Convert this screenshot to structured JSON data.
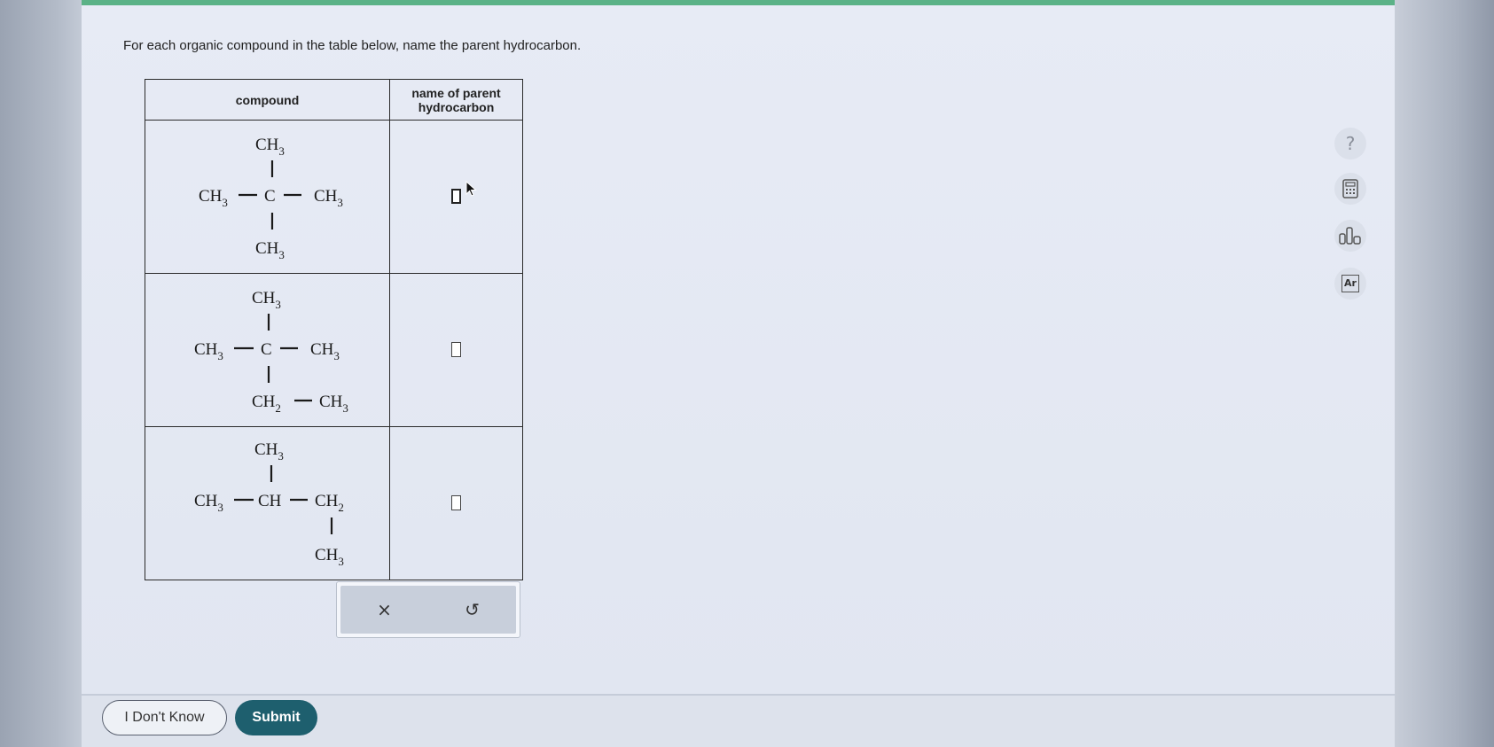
{
  "question": {
    "prompt": "For each organic compound in the table below, name the parent hydrocarbon."
  },
  "table": {
    "headers": [
      "compound",
      "name of parent hydrocarbon"
    ],
    "rows": [
      {
        "compound": {
          "top": "CH3",
          "left": "CH3",
          "center": "C",
          "right": "CH3",
          "bottom": "CH3"
        },
        "answer": ""
      },
      {
        "compound": {
          "top": "CH3",
          "left": "CH3",
          "center": "C",
          "right": "CH3",
          "bottom": "CH2",
          "bottom_right": "CH3"
        },
        "answer": ""
      },
      {
        "compound": {
          "top": "CH3",
          "left": "CH3",
          "center": "CH",
          "right": "CH2",
          "right_bottom": "CH3"
        },
        "answer": ""
      }
    ]
  },
  "actions": {
    "clear_symbol": "×",
    "undo_symbol": "↺"
  },
  "tools": {
    "help_symbol": "?",
    "periodic_label": "Ar",
    "icons": [
      "help-icon",
      "calculator-icon",
      "data-chart-icon",
      "periodic-table-icon"
    ]
  },
  "footer": {
    "dont_know_label": "I Don't Know",
    "submit_label": "Submit"
  },
  "colors": {
    "top_accent": "#5bb287",
    "submit_bg": "#1e5f6e"
  }
}
